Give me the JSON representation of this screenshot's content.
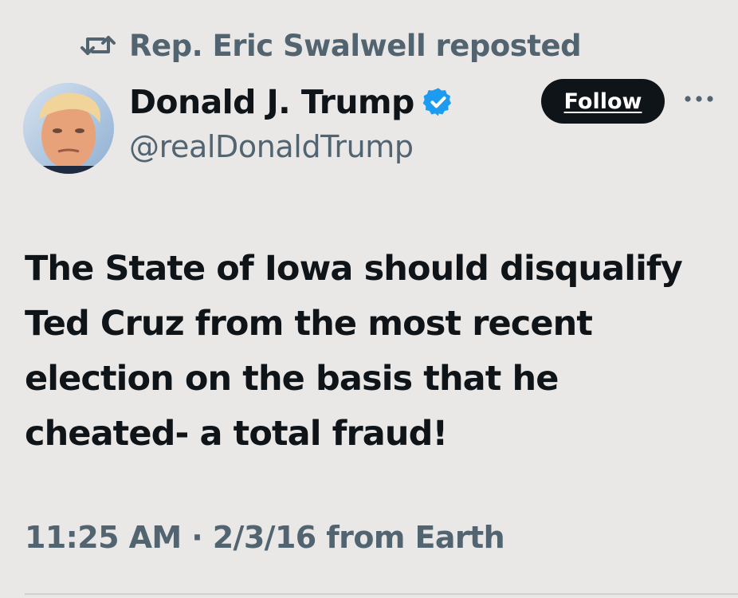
{
  "repost": {
    "icon": "repost-icon",
    "text": "Rep. Eric Swalwell reposted"
  },
  "author": {
    "avatar_icon": "avatar-photo",
    "display_name": "Donald J. Trump",
    "verified_icon": "verified-badge-icon",
    "handle": "@realDonaldTrump"
  },
  "follow_button": {
    "label": "Follow"
  },
  "more": {
    "icon": "more-dots-icon",
    "glyph": "···"
  },
  "post": {
    "text": "The State of Iowa should disqualify Ted Cruz from the most recent election on the basis that he cheated- a total fraud!"
  },
  "meta": {
    "timestamp": "11:25 AM · 2/3/16 from Earth"
  },
  "colors": {
    "background": "#e9e8e7",
    "primary_text": "#0f1419",
    "secondary_text": "#536471",
    "verified_blue": "#1d9bf0",
    "follow_bg": "#0f1419",
    "follow_text": "#ffffff"
  }
}
